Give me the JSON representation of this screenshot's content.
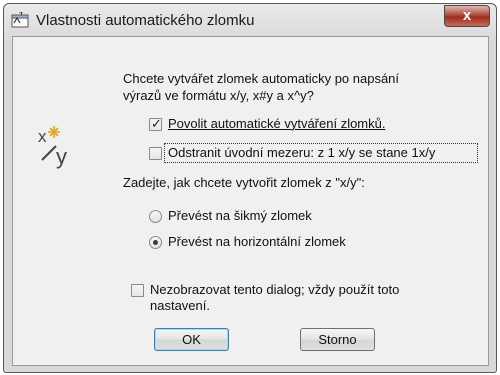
{
  "window": {
    "title": "Vlastnosti automatického zlomku",
    "close_label": "x",
    "icon": "app-window-icon"
  },
  "dialog": {
    "icon": "fraction-xy-icon",
    "prompt_line1": "Chcete vytvářet zlomek automaticky po napsání",
    "prompt_line2": "výrazů ve formátu x/y, x#y a x^y?",
    "checkbox_enable": {
      "label": "Povolit automatické vytváření zlomků.",
      "checked": true
    },
    "checkbox_remove_space": {
      "label": "Odstranit úvodní mezeru:  z 1 x/y se stane 1x/y",
      "checked": false
    },
    "question": "Zadejte, jak chcete vytvořit zlomek z \"x/y\":",
    "radio_skewed": {
      "label": "Převést na šikmý zlomek",
      "selected": false
    },
    "radio_horizontal": {
      "label": "Převést na horizontální zlomek",
      "selected": true
    },
    "checkbox_dont_show": {
      "label_line1": "Nezobrazovat tento dialog; vždy použít toto",
      "label_line2": "nastavení.",
      "checked": false
    },
    "ok_label": "OK",
    "cancel_label": "Storno"
  }
}
